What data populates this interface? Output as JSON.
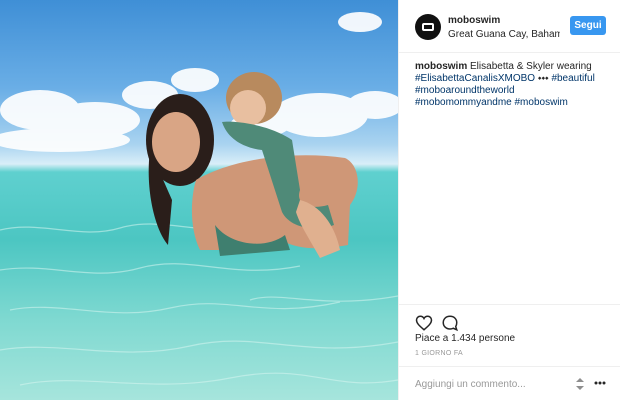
{
  "post": {
    "username": "moboswim",
    "location": "Great Guana Cay, Bahamas",
    "follow_label": "Segui",
    "caption": {
      "user": "moboswim",
      "text": "Elisabetta & Skyler wearing",
      "hashtags": [
        "#ElisabettaCanalisXMOBO",
        "#beautiful",
        "#moboaroundtheworld",
        "#mobomommyandme",
        "#moboswim"
      ],
      "emoji": "⬩⬩⬩"
    },
    "likes": "Piace a 1.434 persone",
    "time": "1 GIORNO FA",
    "comment_placeholder": "Aggiungi un commento..."
  },
  "icons": {
    "like": "heart-outline-icon",
    "comment": "speech-bubble-icon",
    "sort": "up-down-arrows-icon",
    "more": "ellipsis-icon"
  },
  "colors": {
    "accent": "#3897f0",
    "hashtag": "#003569",
    "muted": "#999999"
  }
}
